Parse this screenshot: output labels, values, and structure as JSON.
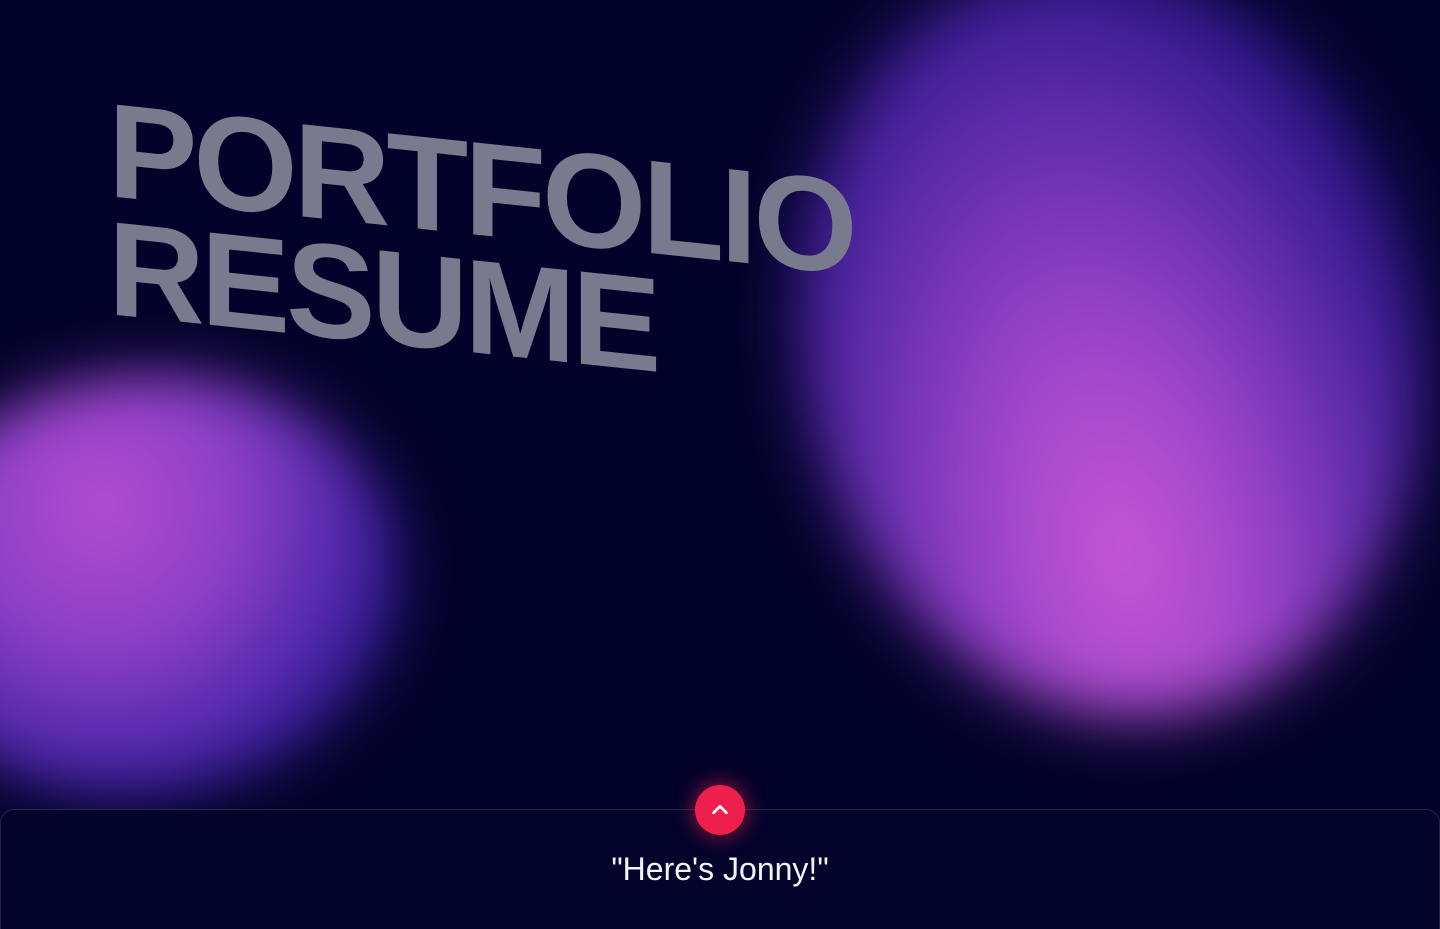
{
  "hero": {
    "line1": "PORTFOLIO",
    "line2": "RESUME"
  },
  "footer": {
    "quote": "\"Here's Jonny!\"",
    "scroll_top_icon": "chevron-up-icon"
  },
  "colors": {
    "background": "#03022a",
    "title": "#7a7a8e",
    "accent_button": "#ef1f4d",
    "blob_pink": "#c758d6",
    "blob_blue": "#24127e"
  }
}
